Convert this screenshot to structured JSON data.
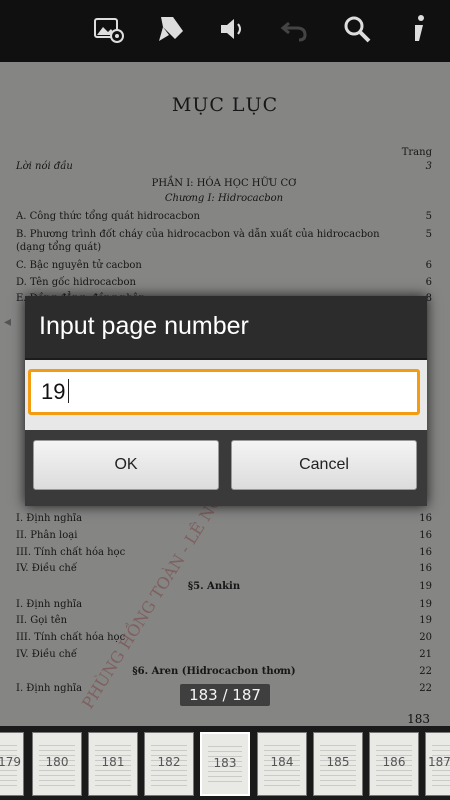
{
  "toolbar": {
    "icons": [
      "image-settings-icon",
      "bookmark-icon",
      "volume-icon",
      "undo-icon",
      "search-icon",
      "info-icon"
    ]
  },
  "document": {
    "title": "MỤC LỤC",
    "trang_label": "Trang",
    "lines": [
      {
        "text": "Lời nói đầu",
        "page": "3"
      },
      {
        "text": "PHẦN I: HÓA HỌC HỮU CƠ",
        "page": ""
      },
      {
        "text": "Chương I: Hidrocacbon",
        "page": ""
      },
      {
        "text": "A. Công thức tổng quát hidrocacbon",
        "page": "5"
      },
      {
        "text": "B. Phương trình đốt cháy của hidrocacbon và dẫn xuất của hidrocacbon",
        "page": "5"
      },
      {
        "text": "(dạng tổng quát)",
        "page": ""
      },
      {
        "text": "C. Bậc nguyên tử cacbon",
        "page": "6"
      },
      {
        "text": "D. Tên gốc hidrocacbon",
        "page": "6"
      },
      {
        "text": "E. Đồng đẳng, đồng phân",
        "page": "8"
      },
      {
        "text": "I. Định nghĩa",
        "page": "16"
      },
      {
        "text": "II. Phân loại",
        "page": "16"
      },
      {
        "text": "III. Tính chất hóa học",
        "page": "16"
      },
      {
        "text": "IV. Điều chế",
        "page": "16"
      },
      {
        "text": "§5. Ankin",
        "page": "19"
      },
      {
        "text": "I. Định nghĩa",
        "page": "19"
      },
      {
        "text": "II. Gọi tên",
        "page": "19"
      },
      {
        "text": "III. Tính chất hóa học",
        "page": "20"
      },
      {
        "text": "IV. Điều chế",
        "page": "21"
      },
      {
        "text": "§6. Aren (Hidrocacbon thơm)",
        "page": "22"
      },
      {
        "text": "I. Định nghĩa",
        "page": "22"
      }
    ],
    "footer_page": "183",
    "watermark": "PHÙNG HỒNG TOÀN - LÊ NGỌC HÙNG ĐẠO TP.HCM"
  },
  "page_indicator": "183 / 187",
  "thumbnails": [
    "179",
    "180",
    "181",
    "182",
    "183",
    "184",
    "185",
    "186",
    "187"
  ],
  "thumbnail_current": "183",
  "dialog": {
    "title": "Input page number",
    "input_value": "19",
    "ok_label": "OK",
    "cancel_label": "Cancel"
  }
}
